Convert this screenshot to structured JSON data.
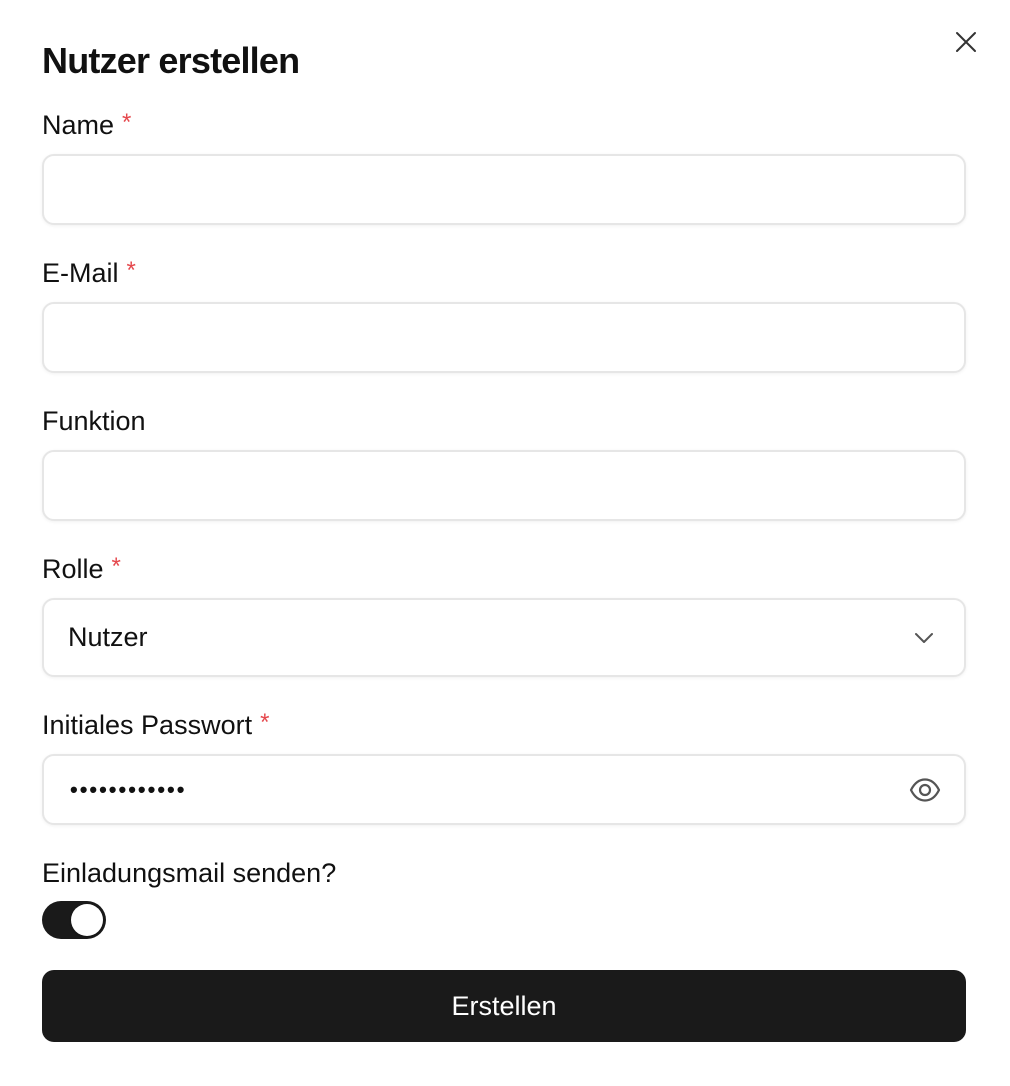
{
  "dialog": {
    "title": "Nutzer erstellen",
    "close_icon": "close-icon"
  },
  "form": {
    "name": {
      "label": "Name",
      "required_mark": "*",
      "value": "",
      "placeholder": ""
    },
    "email": {
      "label": "E-Mail",
      "required_mark": "*",
      "value": "",
      "placeholder": ""
    },
    "function": {
      "label": "Funktion",
      "value": "",
      "placeholder": ""
    },
    "role": {
      "label": "Rolle",
      "required_mark": "*",
      "selected": "Nutzer",
      "icon": "chevron-down-icon"
    },
    "password": {
      "label": "Initiales Passwort",
      "required_mark": "*",
      "masked_value": "••••••••••••",
      "icon": "eye-icon"
    },
    "invite": {
      "label": "Einladungsmail senden?",
      "enabled": true
    },
    "submit_label": "Erstellen"
  },
  "colors": {
    "required": "#e5484d",
    "primary": "#1a1a1a",
    "border": "#e6e6e6"
  }
}
